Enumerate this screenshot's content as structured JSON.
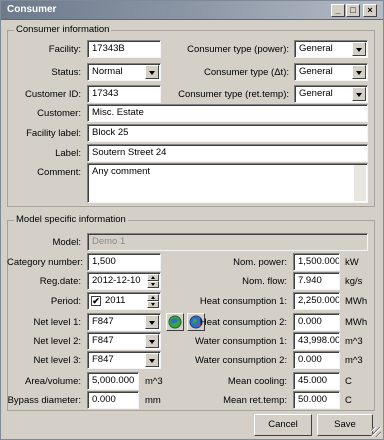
{
  "window": {
    "title": "Consumer",
    "minimize": "_",
    "maximize": "□",
    "close": "×"
  },
  "consumer_info": {
    "group_label": "Consumer information",
    "facility": {
      "label": "Facility:",
      "value": "17343B"
    },
    "status": {
      "label": "Status:",
      "value": "Normal"
    },
    "customer_id": {
      "label": "Customer ID:",
      "value": "17343"
    },
    "consumer_type_power": {
      "label": "Consumer type (power):",
      "value": "General"
    },
    "consumer_type_dt": {
      "label": "Consumer type (Δt):",
      "value": "General"
    },
    "consumer_type_ret": {
      "label": "Consumer type (ret.temp):",
      "value": "General"
    },
    "customer": {
      "label": "Customer:",
      "value": "Misc. Estate"
    },
    "facility_label": {
      "label": "Facility label:",
      "value": "Block 25"
    },
    "address": {
      "label": "Label:",
      "value": "Soutern Street 24"
    },
    "comment": {
      "label": "Comment:",
      "value": "Any comment"
    }
  },
  "model_info": {
    "group_label": "Model specific information",
    "model": {
      "label": "Model:",
      "value": "Demo 1"
    },
    "category_number": {
      "label": "Category number:",
      "value": "1,500"
    },
    "reg_date": {
      "label": "Reg.date:",
      "value": "2012-12-10"
    },
    "period": {
      "label": "Period:",
      "value": "2011",
      "checked": true,
      "check_glyph": "✔"
    },
    "net_level_1": {
      "label": "Net level 1:",
      "value": "F847"
    },
    "net_level_2": {
      "label": "Net level 2:",
      "value": "F847"
    },
    "net_level_3": {
      "label": "Net level 3:",
      "value": "F847"
    },
    "area_volume": {
      "label": "Area/volume:",
      "value": "5,000.000",
      "unit": "m^3"
    },
    "bypass_diameter": {
      "label": "Bypass diameter:",
      "value": "0.000",
      "unit": "mm"
    },
    "nom_power": {
      "label": "Nom. power:",
      "value": "1,500.000",
      "unit": "kW"
    },
    "nom_flow": {
      "label": "Nom. flow:",
      "value": "7.940",
      "unit": "kg/s"
    },
    "heat_consumption_1": {
      "label": "Heat consumption 1:",
      "value": "2,250.000",
      "unit": "MWh"
    },
    "heat_consumption_2": {
      "label": "Heat consumption 2:",
      "value": "0.000",
      "unit": "MWh"
    },
    "water_consumption_1": {
      "label": "Water consumption 1:",
      "value": "43,998.000",
      "unit": "m^3"
    },
    "water_consumption_2": {
      "label": "Water consumption 2:",
      "value": "0.000",
      "unit": "m^3"
    },
    "mean_cooling": {
      "label": "Mean cooling:",
      "value": "45.000",
      "unit": "C"
    },
    "mean_ret_temp": {
      "label": "Mean ret.temp:",
      "value": "50.000",
      "unit": "C"
    }
  },
  "buttons": {
    "cancel": "Cancel",
    "save": "Save"
  },
  "icons": {
    "net_level_1_a": "globe-icon",
    "net_level_1_b": "map-globe-icon"
  }
}
